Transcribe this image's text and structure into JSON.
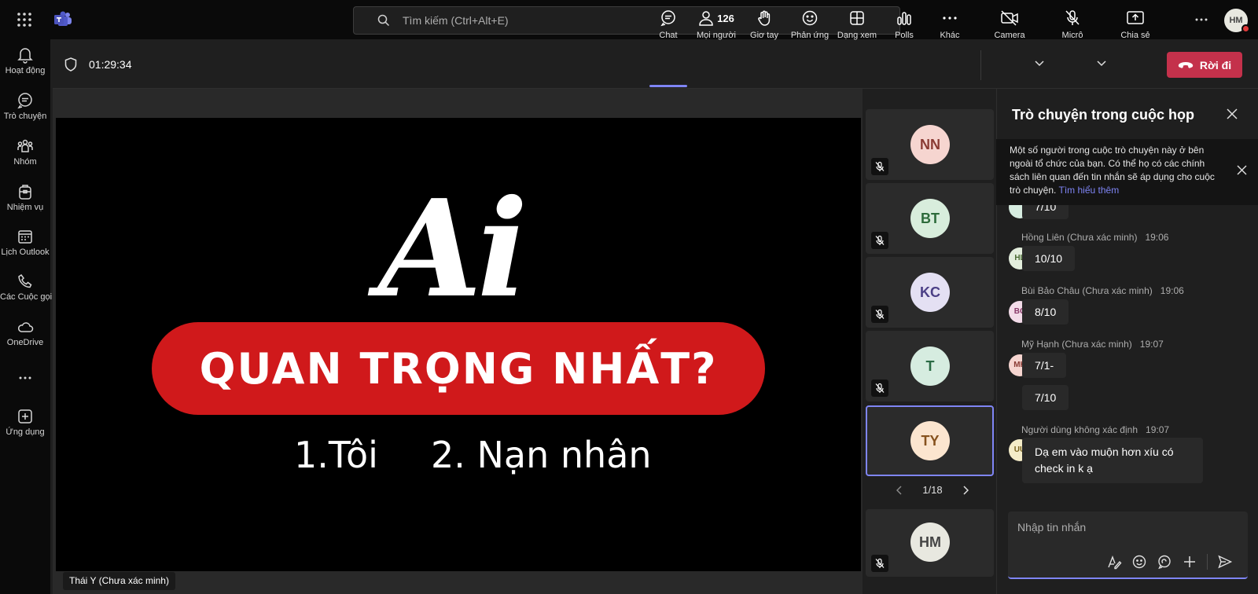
{
  "topbar": {
    "search_placeholder": "Tìm kiếm (Ctrl+Alt+E)",
    "more_label": "...",
    "avatar_initials": "HM"
  },
  "rail": {
    "items": [
      {
        "label": "Hoạt động",
        "icon": "bell-icon"
      },
      {
        "label": "Trò chuyện",
        "icon": "chat-icon"
      },
      {
        "label": "Nhóm",
        "icon": "teams-icon"
      },
      {
        "label": "Nhiệm vụ",
        "icon": "tasks-icon"
      },
      {
        "label": "Lịch Outlook",
        "icon": "calendar-icon"
      },
      {
        "label": "Các Cuộc gọi",
        "icon": "phone-icon"
      },
      {
        "label": "OneDrive",
        "icon": "cloud-icon"
      },
      {
        "label": "...",
        "icon": "more-icon"
      },
      {
        "label": "Ứng dụng",
        "icon": "add-app-icon"
      }
    ]
  },
  "meeting": {
    "timer": "01:29:34",
    "participants_count": "126",
    "toolbar": {
      "chat": "Chat",
      "people": "Mọi người",
      "raise_hand": "Giơ tay",
      "react": "Phản ứng",
      "view": "Dạng xem",
      "polls": "Polls",
      "more": "Khác",
      "camera": "Camera",
      "mic": "Micrô",
      "share": "Chia sẻ",
      "leave": "Rời đi"
    }
  },
  "stage": {
    "slide": {
      "big_word": "Ai",
      "headline": "QUAN TRỌNG NHẤT?",
      "option1": "1.Tôi",
      "option2": "2. Nạn nhân"
    },
    "presenter_name": "Thái Y (Chưa xác minh)",
    "colors": {
      "headline_bg": "#d0191b"
    }
  },
  "tiles": [
    {
      "initials": "NN",
      "bg": "#f6d5d0",
      "fg": "#8a3a33",
      "muted": true
    },
    {
      "initials": "BT",
      "bg": "#d8eddc",
      "fg": "#2d6b3b",
      "muted": true
    },
    {
      "initials": "KC",
      "bg": "#e4e0f3",
      "fg": "#4b3f86",
      "muted": true
    },
    {
      "initials": "T",
      "bg": "#d6ece0",
      "fg": "#2b6b45",
      "muted": true
    },
    {
      "initials": "TY",
      "bg": "#fbe5cf",
      "fg": "#86521e",
      "muted": false,
      "selected": true
    },
    {
      "initials": "HM",
      "bg": "#e8e8e0",
      "fg": "#444444",
      "muted": true
    }
  ],
  "pager": {
    "label": "1/18"
  },
  "chat": {
    "title": "Trò chuyện trong cuộc họp",
    "banner_text": "Một số người trong cuộc trò chuyện này ở bên ngoài tổ chức của bạn. Có thể họ có các chính sách liên quan đến tin nhắn sẽ áp dụng cho cuộc trò chuyện.",
    "banner_link": "Tìm hiểu thêm",
    "partial_message": "7/10",
    "messages": [
      {
        "author": "Hồng Liên (Chưa xác minh)",
        "time": "19:06",
        "initials": "HL",
        "text": "10/10"
      },
      {
        "author": "Bùi Bảo Châu (Chưa xác minh)",
        "time": "19:06",
        "initials": "BC",
        "text": "8/10"
      },
      {
        "author": "Mỹ Hạnh (Chưa xác minh)",
        "time": "19:07",
        "initials": "MH",
        "text": "7/1-",
        "text2": "7/10"
      },
      {
        "author": "Người dùng không xác định",
        "time": "19:07",
        "initials": "UU",
        "text": "Dạ em vào muộn hơn xíu có check in k ạ"
      }
    ],
    "compose_placeholder": "Nhập tin nhắn"
  }
}
